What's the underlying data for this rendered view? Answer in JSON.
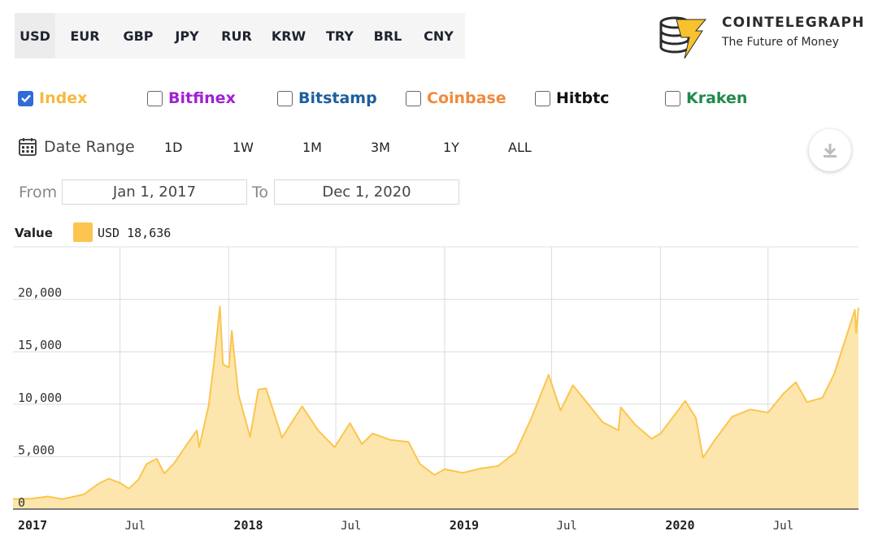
{
  "currencies": [
    {
      "label": "USD",
      "active": true
    },
    {
      "label": "EUR",
      "active": false
    },
    {
      "label": "GBP",
      "active": false
    },
    {
      "label": "JPY",
      "active": false
    },
    {
      "label": "RUR",
      "active": false
    },
    {
      "label": "KRW",
      "active": false
    },
    {
      "label": "TRY",
      "active": false
    },
    {
      "label": "BRL",
      "active": false
    },
    {
      "label": "CNY",
      "active": false
    }
  ],
  "logo": {
    "name": "COINTELEGRAPH",
    "tagline": "The Future of Money",
    "icon": "cointelegraph-logo-icon"
  },
  "sources": [
    {
      "label": "Index",
      "checked": true,
      "color": "#f5b942"
    },
    {
      "label": "Bitfinex",
      "checked": false,
      "color": "#a020d8"
    },
    {
      "label": "Bitstamp",
      "checked": false,
      "color": "#1d5e9e"
    },
    {
      "label": "Coinbase",
      "checked": false,
      "color": "#f08a3e"
    },
    {
      "label": "Hitbtc",
      "checked": false,
      "color": "#111111"
    },
    {
      "label": "Kraken",
      "checked": false,
      "color": "#1f8a4c"
    }
  ],
  "range": {
    "label": "Date Range",
    "icon": "calendar-icon",
    "buttons": [
      "1D",
      "1W",
      "1M",
      "3M",
      "1Y",
      "ALL"
    ],
    "from_label": "From",
    "from_value": "Jan 1, 2017",
    "to_label": "To",
    "to_value": "Dec 1, 2020",
    "download_icon": "download-icon"
  },
  "value_legend": {
    "label": "Value",
    "text": "USD 18,636",
    "color": "#fbc54f"
  },
  "chart_data": {
    "type": "area",
    "series": [
      {
        "name": "USD",
        "color": "#fbc54f",
        "points": [
          [
            "2017-01-01",
            960
          ],
          [
            "2017-02-01",
            1000
          ],
          [
            "2017-03-01",
            1200
          ],
          [
            "2017-03-25",
            950
          ],
          [
            "2017-04-15",
            1200
          ],
          [
            "2017-05-01",
            1400
          ],
          [
            "2017-05-25",
            2400
          ],
          [
            "2017-06-12",
            2900
          ],
          [
            "2017-07-01",
            2500
          ],
          [
            "2017-07-16",
            1950
          ],
          [
            "2017-08-01",
            2800
          ],
          [
            "2017-08-15",
            4300
          ],
          [
            "2017-09-01",
            4800
          ],
          [
            "2017-09-14",
            3400
          ],
          [
            "2017-10-01",
            4400
          ],
          [
            "2017-10-20",
            6000
          ],
          [
            "2017-11-08",
            7500
          ],
          [
            "2017-11-12",
            5900
          ],
          [
            "2017-11-28",
            9900
          ],
          [
            "2017-12-07",
            14000
          ],
          [
            "2017-12-17",
            19300
          ],
          [
            "2017-12-22",
            13800
          ],
          [
            "2018-01-01",
            13500
          ],
          [
            "2018-01-06",
            17000
          ],
          [
            "2018-01-17",
            11000
          ],
          [
            "2018-02-06",
            6900
          ],
          [
            "2018-02-20",
            11400
          ],
          [
            "2018-03-05",
            11500
          ],
          [
            "2018-04-01",
            6800
          ],
          [
            "2018-05-05",
            9800
          ],
          [
            "2018-06-01",
            7500
          ],
          [
            "2018-06-29",
            5900
          ],
          [
            "2018-07-25",
            8200
          ],
          [
            "2018-08-14",
            6200
          ],
          [
            "2018-09-01",
            7200
          ],
          [
            "2018-10-01",
            6600
          ],
          [
            "2018-11-01",
            6400
          ],
          [
            "2018-11-20",
            4300
          ],
          [
            "2018-12-15",
            3250
          ],
          [
            "2019-01-01",
            3800
          ],
          [
            "2019-02-01",
            3450
          ],
          [
            "2019-03-01",
            3850
          ],
          [
            "2019-04-01",
            4100
          ],
          [
            "2019-05-01",
            5400
          ],
          [
            "2019-05-28",
            8700
          ],
          [
            "2019-06-26",
            12800
          ],
          [
            "2019-07-16",
            9400
          ],
          [
            "2019-08-06",
            11800
          ],
          [
            "2019-09-01",
            10000
          ],
          [
            "2019-09-25",
            8300
          ],
          [
            "2019-10-22",
            7500
          ],
          [
            "2019-10-26",
            9700
          ],
          [
            "2019-11-20",
            8000
          ],
          [
            "2019-12-17",
            6700
          ],
          [
            "2020-01-01",
            7200
          ],
          [
            "2020-02-12",
            10300
          ],
          [
            "2020-03-01",
            8700
          ],
          [
            "2020-03-13",
            4900
          ],
          [
            "2020-04-01",
            6500
          ],
          [
            "2020-05-01",
            8800
          ],
          [
            "2020-06-01",
            9500
          ],
          [
            "2020-07-01",
            9200
          ],
          [
            "2020-07-27",
            11000
          ],
          [
            "2020-08-17",
            12100
          ],
          [
            "2020-09-05",
            10200
          ],
          [
            "2020-10-01",
            10600
          ],
          [
            "2020-10-21",
            12900
          ],
          [
            "2020-11-05",
            15500
          ],
          [
            "2020-11-25",
            19000
          ],
          [
            "2020-11-27",
            16800
          ],
          [
            "2020-12-01",
            19200
          ]
        ]
      }
    ],
    "x_range": [
      "2017-01-01",
      "2020-12-01"
    ],
    "ylim": [
      0,
      25000
    ],
    "y_ticks": [
      0,
      5000,
      10000,
      15000,
      20000
    ],
    "y_tick_labels": [
      "0",
      "5,000",
      "10,000",
      "15,000",
      "20,000"
    ],
    "x_ticks": [
      {
        "date": "2017-01-01",
        "label": "2017",
        "major": true
      },
      {
        "date": "2017-07-01",
        "label": "Jul",
        "major": false
      },
      {
        "date": "2018-01-01",
        "label": "2018",
        "major": true
      },
      {
        "date": "2018-07-01",
        "label": "Jul",
        "major": false
      },
      {
        "date": "2019-01-01",
        "label": "2019",
        "major": true
      },
      {
        "date": "2019-07-01",
        "label": "Jul",
        "major": false
      },
      {
        "date": "2020-01-01",
        "label": "2020",
        "major": true
      },
      {
        "date": "2020-07-01",
        "label": "Jul",
        "major": false
      }
    ],
    "grid": true
  }
}
